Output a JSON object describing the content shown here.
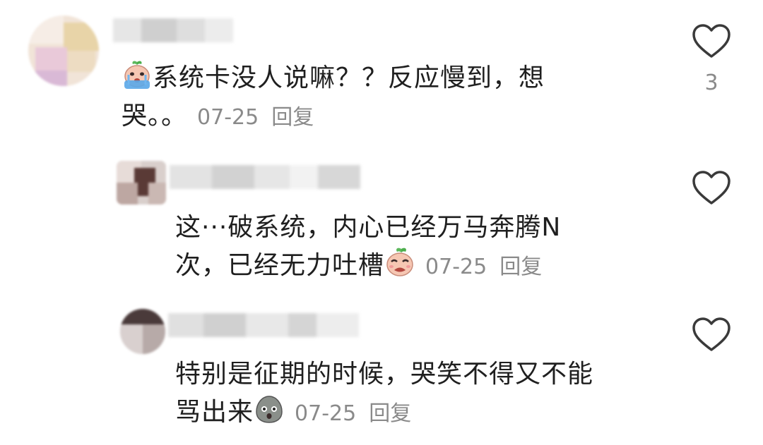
{
  "comments": [
    {
      "text_before": "系统卡没人说嘛？？反应慢到，想",
      "text_line2": "哭。。",
      "emoji": "crying-sprout-face",
      "date": "07-25",
      "reply_label": "回复",
      "likes": "3"
    },
    {
      "text_line1": "这···破系统，内心已经万马奔腾N",
      "text_line2": "次，已经无力吐槽",
      "emoji": "sobbing-sprout-face",
      "date": "07-25",
      "reply_label": "回复",
      "likes": ""
    },
    {
      "text_line1": "特别是征期的时候，哭笑不得又不能",
      "text_line2": "骂出来",
      "emoji": "gray-shocked-blob-face",
      "date": "07-25",
      "reply_label": "回复",
      "likes": ""
    }
  ],
  "icons": {
    "like": "heart-outline-icon"
  },
  "colors": {
    "text": "#1f1f1f",
    "meta": "#8a8a8a",
    "heart_stroke": "#3a3a3a"
  }
}
